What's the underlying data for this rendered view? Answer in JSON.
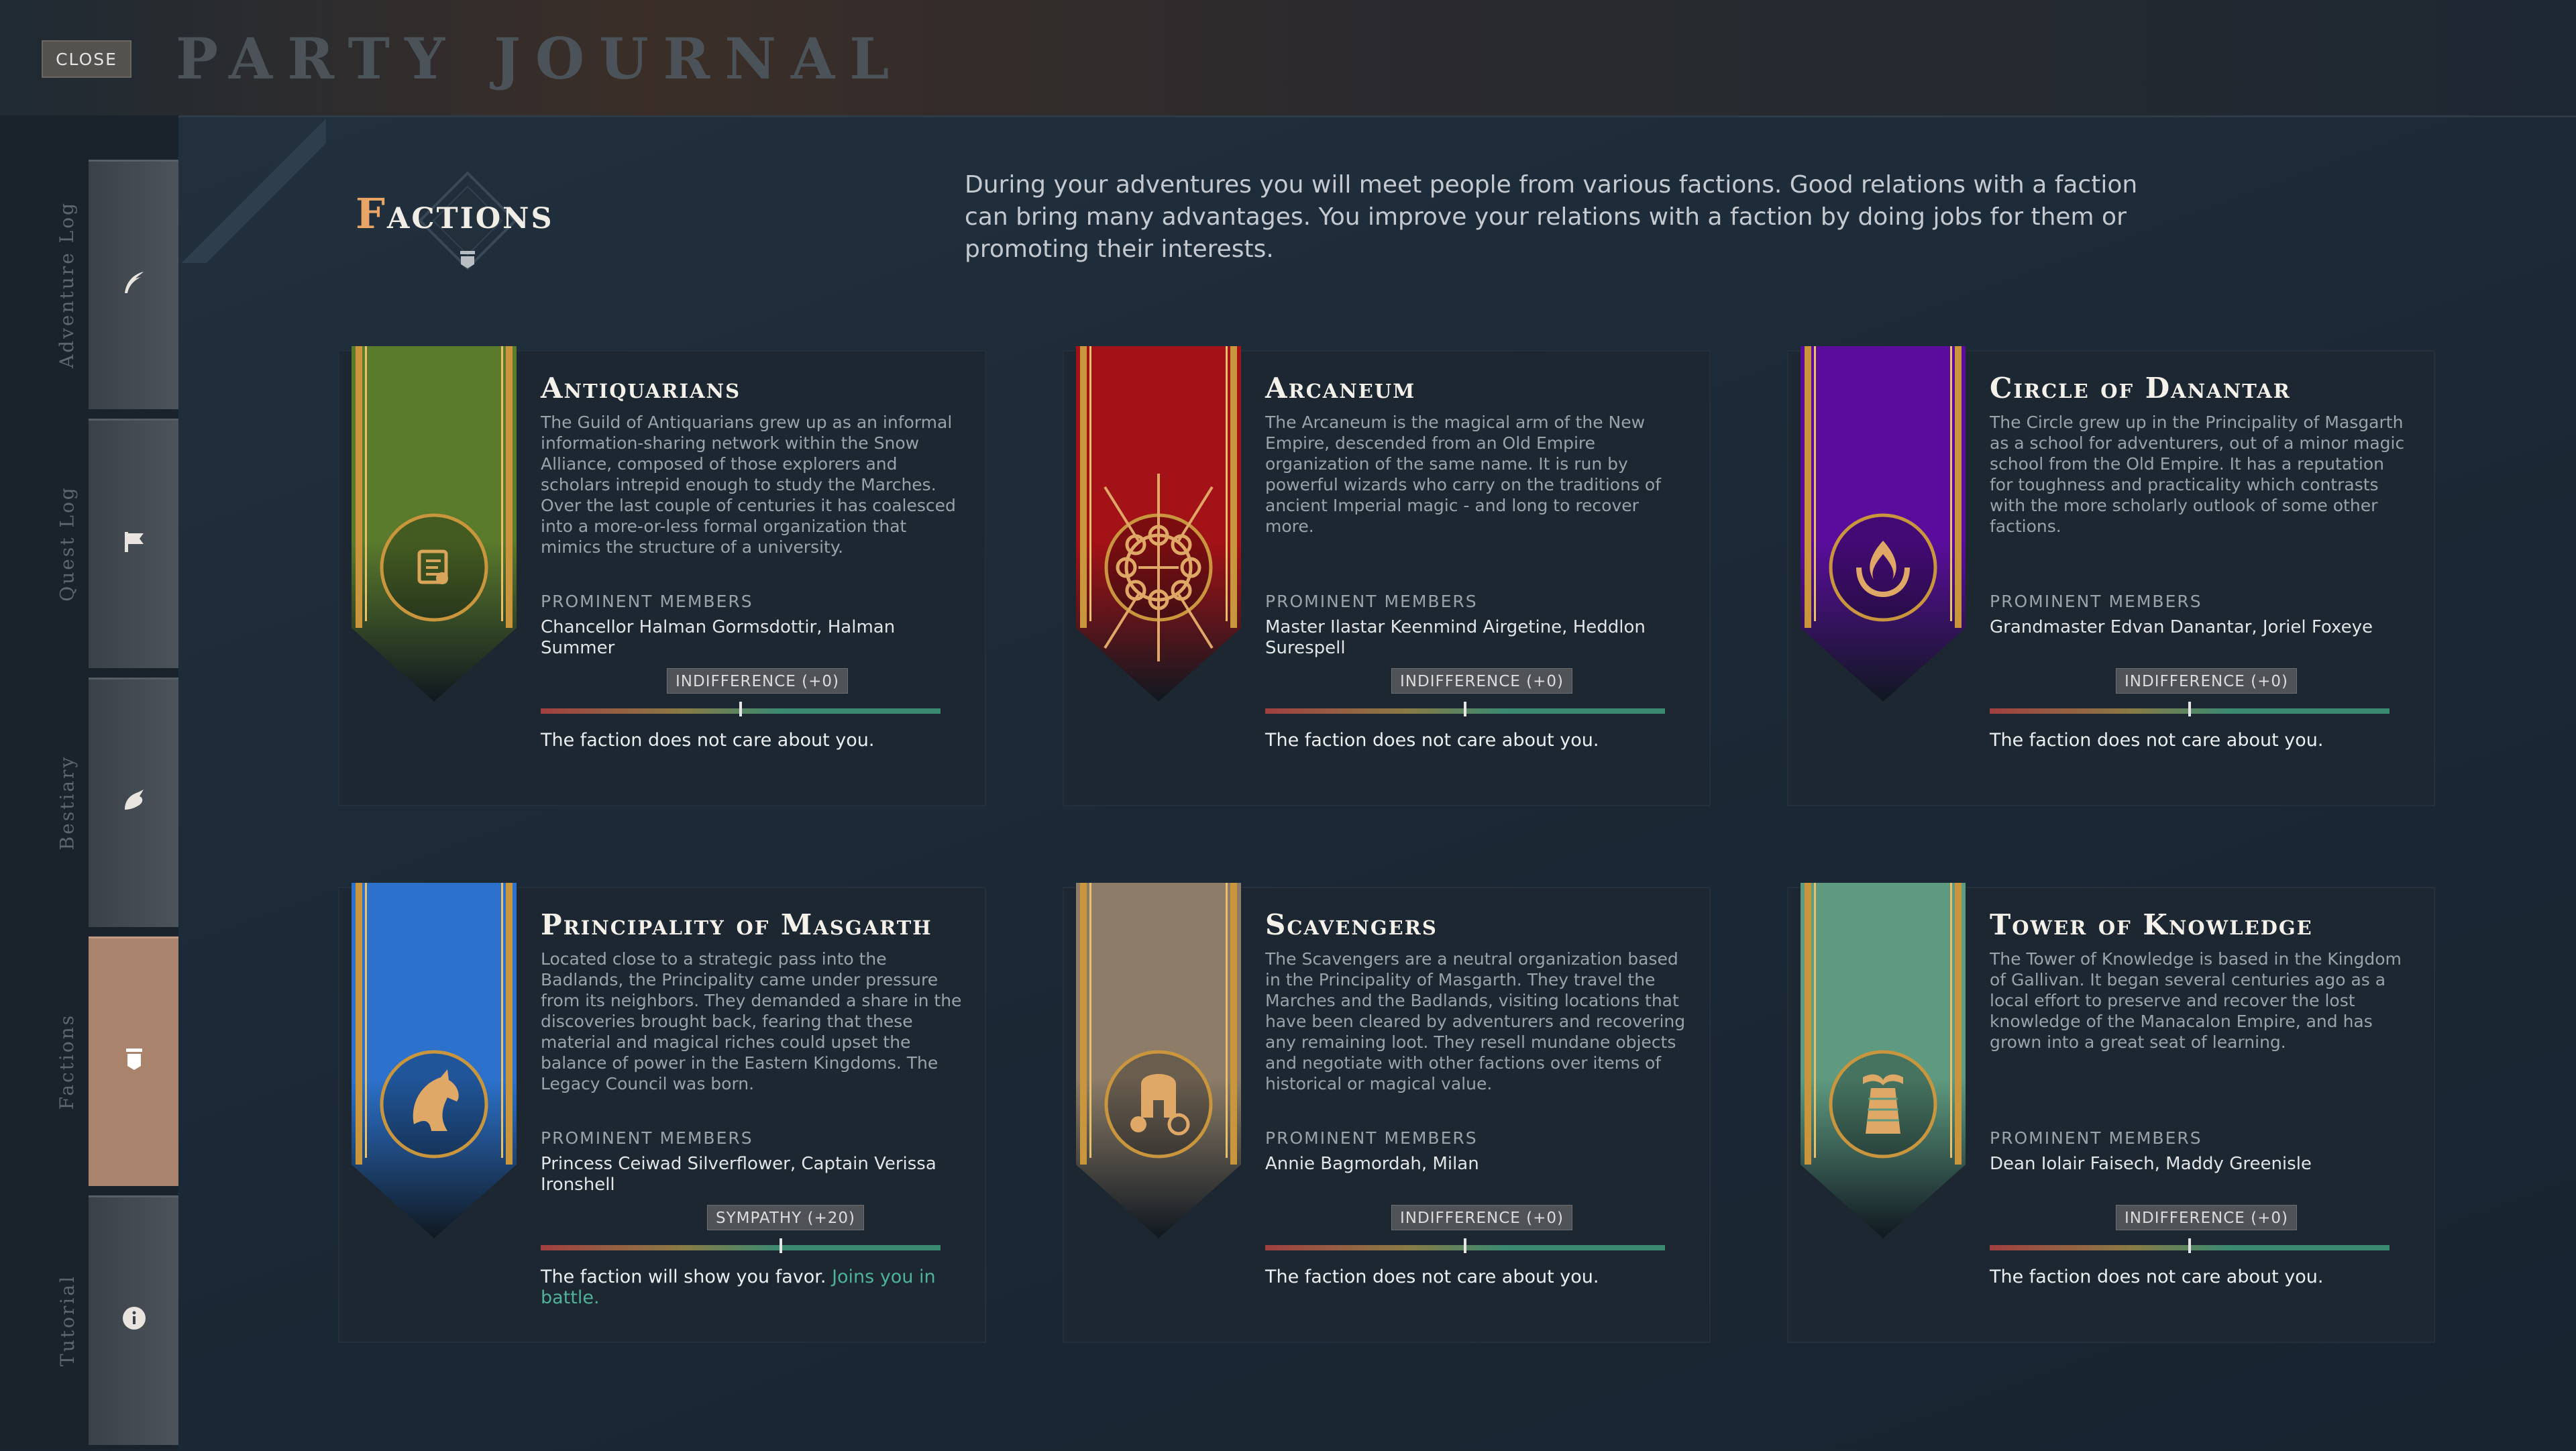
{
  "header": {
    "close_label": "CLOSE",
    "title": "PARTY JOURNAL"
  },
  "sidebar": {
    "tabs": [
      {
        "label": "Adventure Log",
        "icon": "quill-icon",
        "active": false
      },
      {
        "label": "Quest Log",
        "icon": "flag-icon",
        "active": false
      },
      {
        "label": "Bestiary",
        "icon": "claw-icon",
        "active": false
      },
      {
        "label": "Factions",
        "icon": "banner-icon",
        "active": true
      },
      {
        "label": "Tutorial",
        "icon": "info-icon",
        "active": false
      }
    ]
  },
  "section": {
    "title_first": "F",
    "title_rest": "actions",
    "intro": "During your adventures you will meet people from various factions. Good relations with a faction can bring many advantages. You improve your relations with a faction by doing jobs for them or promoting their interests."
  },
  "members_label": "PROMINENT MEMBERS",
  "factions": [
    {
      "name": "Antiquarians",
      "description": "The Guild of Antiquarians grew up as an informal information-sharing network within the Snow Alliance, composed of those explorers and scholars intrepid enough to study the Marches. Over the last couple of centuries it has coalesced into a more-or-less formal organization that mimics the structure of a university.",
      "members": "Chancellor Halman Gormsdottir, Halman Summer",
      "relation": "INDIFFERENCE (+0)",
      "relation_level": 0.5,
      "status": "The faction does not care about you.",
      "status_extra": "",
      "banner_color": "#5a7a2c",
      "emblem": "scroll-emblem-icon"
    },
    {
      "name": "Arcaneum",
      "description": "The Arcaneum is the magical arm of the New Empire, descended from an Old Empire organization of the same name. It is run by powerful wizards who carry on the traditions of ancient Imperial magic - and long to recover more.",
      "members": "Master Ilastar Keenmind Airgetine, Heddlon Surespell",
      "relation": "INDIFFERENCE (+0)",
      "relation_level": 0.5,
      "status": "The faction does not care about you.",
      "status_extra": "",
      "banner_color": "#a31216",
      "emblem": "sun-circle-emblem-icon"
    },
    {
      "name": "Circle of Danantar",
      "description": "The Circle grew up in the Principality of Masgarth as a school for adventurers, out of a minor magic school from the Old Empire. It has a reputation for toughness and practicality which contrasts with the more scholarly outlook of some other factions.",
      "members": "Grandmaster Edvan Danantar, Joriel Foxeye",
      "relation": "INDIFFERENCE (+0)",
      "relation_level": 0.5,
      "status": "The faction does not care about you.",
      "status_extra": "",
      "banner_color": "#5a0d9c",
      "emblem": "flame-hands-emblem-icon"
    },
    {
      "name": "Principality of Masgarth",
      "description": "Located close to a strategic pass into the Badlands, the Principality came under pressure from its neighbors. They demanded a share in the discoveries brought back, fearing that these material and magical riches could upset the balance of power in the Eastern Kingdoms. The Legacy Council was born.",
      "members": "Princess Ceiwad Silverflower, Captain Verissa Ironshell",
      "relation": "SYMPATHY (+20)",
      "relation_level": 0.6,
      "status": "The faction will show you favor.",
      "status_extra": "Joins you in battle.",
      "banner_color": "#2c72cc",
      "emblem": "horse-emblem-icon"
    },
    {
      "name": "Scavengers",
      "description": "The Scavengers are a neutral organization based in the Principality of Masgarth. They travel the Marches and the Badlands, visiting locations that have been cleared by adventurers and recovering any remaining loot. They resell mundane objects and negotiate with other factions over items of historical or magical value.",
      "members": "Annie Bagmordah, Milan",
      "relation": "INDIFFERENCE (+0)",
      "relation_level": 0.5,
      "status": "The faction does not care about you.",
      "status_extra": "",
      "banner_color": "#8c7c68",
      "emblem": "helmet-emblem-icon"
    },
    {
      "name": "Tower of Knowledge",
      "description": "The Tower of Knowledge is based in the Kingdom of Gallivan. It began several centuries ago as a local effort to preserve and recover the lost knowledge of the Manacalon Empire, and has grown into a great seat of learning.",
      "members": "Dean Iolair Faisech, Maddy Greenisle",
      "relation": "INDIFFERENCE (+0)",
      "relation_level": 0.5,
      "status": "The faction does not care about you.",
      "status_extra": "",
      "banner_color": "#5e9a80",
      "emblem": "tower-book-emblem-icon"
    }
  ]
}
